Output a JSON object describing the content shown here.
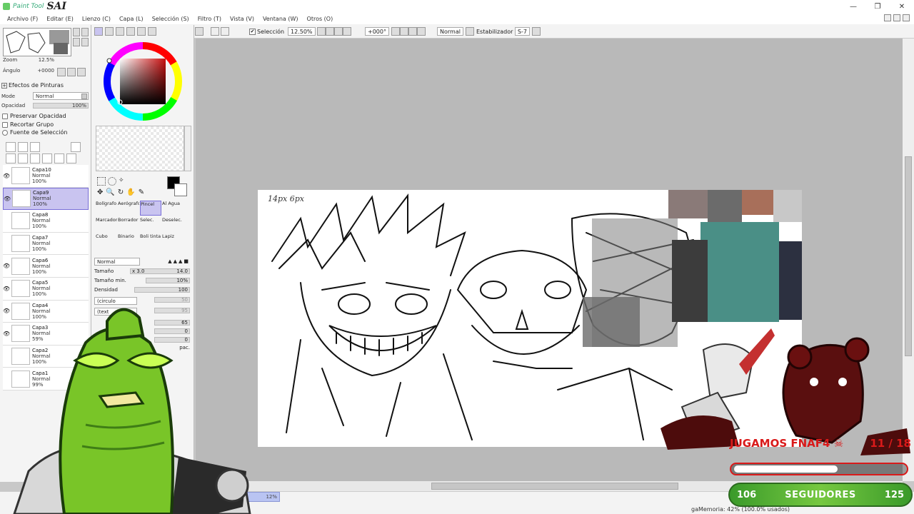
{
  "app": {
    "logo_small": "Paint Tool",
    "logo_big": "SAI"
  },
  "window_buttons": [
    "—",
    "❐",
    "✕"
  ],
  "menu": [
    {
      "label": "Archivo (F)"
    },
    {
      "label": "Editar (E)"
    },
    {
      "label": "Lienzo (C)"
    },
    {
      "label": "Capa (L)"
    },
    {
      "label": "Selección (S)"
    },
    {
      "label": "Filtro (T)"
    },
    {
      "label": "Vista (V)"
    },
    {
      "label": "Ventana (W)"
    },
    {
      "label": "Otros (O)"
    }
  ],
  "toolbar": {
    "selection_label": "Selección",
    "zoom_value": "12.50%",
    "angle_value": "+000°",
    "blend_mode": "Normal",
    "stabilizer_label": "Estabilizador",
    "stabilizer_value": "S-7"
  },
  "navigator": {
    "zoom_label": "Zoom",
    "zoom_value": "12.5%",
    "angle_label": "Ángulo",
    "angle_value": "+0000"
  },
  "paint_effects": {
    "title": "Efectos de Pinturas",
    "mode_label": "Mode",
    "mode_value": "Normal",
    "opacity_label": "Opacidad",
    "opacity_value": "100%",
    "options": [
      "Preservar Opacidad",
      "Recortar Grupo",
      "Fuente de Selección"
    ]
  },
  "layers": [
    {
      "name": "Capa10",
      "mode": "Normal",
      "opacity": "100%",
      "visible": true
    },
    {
      "name": "Capa9",
      "mode": "Normal",
      "opacity": "100%",
      "visible": true,
      "active": true
    },
    {
      "name": "Capa8",
      "mode": "Normal",
      "opacity": "100%",
      "visible": false
    },
    {
      "name": "Capa7",
      "mode": "Normal",
      "opacity": "100%",
      "visible": false
    },
    {
      "name": "Capa6",
      "mode": "Normal",
      "opacity": "100%",
      "visible": true
    },
    {
      "name": "Capa5",
      "mode": "Normal",
      "opacity": "100%",
      "visible": true
    },
    {
      "name": "Capa4",
      "mode": "Normal",
      "opacity": "100%",
      "visible": true
    },
    {
      "name": "Capa3",
      "mode": "Normal",
      "opacity": "59%",
      "visible": true
    },
    {
      "name": "Capa2",
      "mode": "Normal",
      "opacity": "100%",
      "visible": false
    },
    {
      "name": "Capa1",
      "mode": "Normal",
      "opacity": "99%",
      "visible": false
    }
  ],
  "tools": [
    "Bolígrafo",
    "Aerógrafo",
    "Pincel",
    "Al Agua",
    "Marcador",
    "Borrador",
    "Selec.",
    "Deselec.",
    "Cubo",
    "Binario",
    "Boli tinta",
    "Lapiz"
  ],
  "brush": {
    "mode": "Normal",
    "size_label": "Tamaño",
    "size_mult": "x 3.0",
    "size_value": "14.0",
    "min_size_label": "Tamaño min.",
    "min_size_value": "10%",
    "density_label": "Densidad",
    "density_value": "100",
    "shape": "(circulo",
    "texture": "(text",
    "shape_value": "50",
    "texture_value": "95",
    "blend_value": "65",
    "dilution_value": "0",
    "persistence_value": "0",
    "keep_opacity": "pac."
  },
  "canvas": {
    "annotation": "14px 6px"
  },
  "status": {
    "progress": "12%",
    "memory": "gaMemoria: 42% (100.0% usados)"
  },
  "overlay": {
    "banner_text": "JUGAMOS FNAF4 ☠",
    "banner_count": "11 / 18",
    "progress_fraction": 0.61,
    "followers_current": "106",
    "followers_label": "SEGUIDORES",
    "followers_goal": "125"
  },
  "colors": {
    "accent_active": "#c9c4f0",
    "primary_color": "#000000",
    "selected_hue": "#b01e22"
  }
}
